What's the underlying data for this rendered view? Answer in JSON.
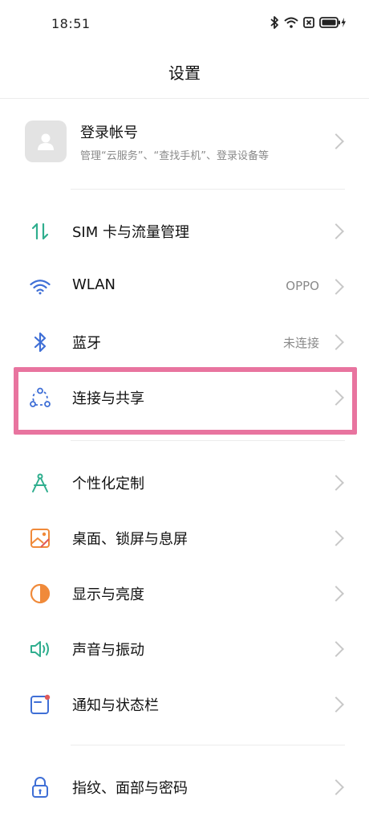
{
  "status_bar": {
    "time": "18:51"
  },
  "header": {
    "title": "设置"
  },
  "account": {
    "name": "登录帐号",
    "description": "管理“云服务”、“查找手机”、登录设备等"
  },
  "settings": [
    {
      "label": "SIM 卡与流量管理",
      "value": "",
      "icon": "sim-data-arrows-icon"
    },
    {
      "label": "WLAN",
      "value": "OPPO",
      "icon": "wifi-icon"
    },
    {
      "label": "蓝牙",
      "value": "未连接",
      "icon": "bluetooth-icon"
    },
    {
      "label": "连接与共享",
      "value": "",
      "icon": "connection-share-icon"
    },
    {
      "label": "个性化定制",
      "value": "",
      "icon": "compass-icon"
    },
    {
      "label": "桌面、锁屏与息屏",
      "value": "",
      "icon": "wallpaper-icon"
    },
    {
      "label": "显示与亮度",
      "value": "",
      "icon": "brightness-icon"
    },
    {
      "label": "声音与振动",
      "value": "",
      "icon": "sound-icon"
    },
    {
      "label": "通知与状态栏",
      "value": "",
      "icon": "notification-icon"
    },
    {
      "label": "指纹、面部与密码",
      "value": "",
      "icon": "lock-icon"
    }
  ],
  "colors": {
    "highlight": "#e8749f",
    "icon_green": "#2fae8e",
    "icon_blue": "#3f6fd6",
    "icon_orange": "#f08a3a",
    "icon_red": "#e05a5a"
  }
}
